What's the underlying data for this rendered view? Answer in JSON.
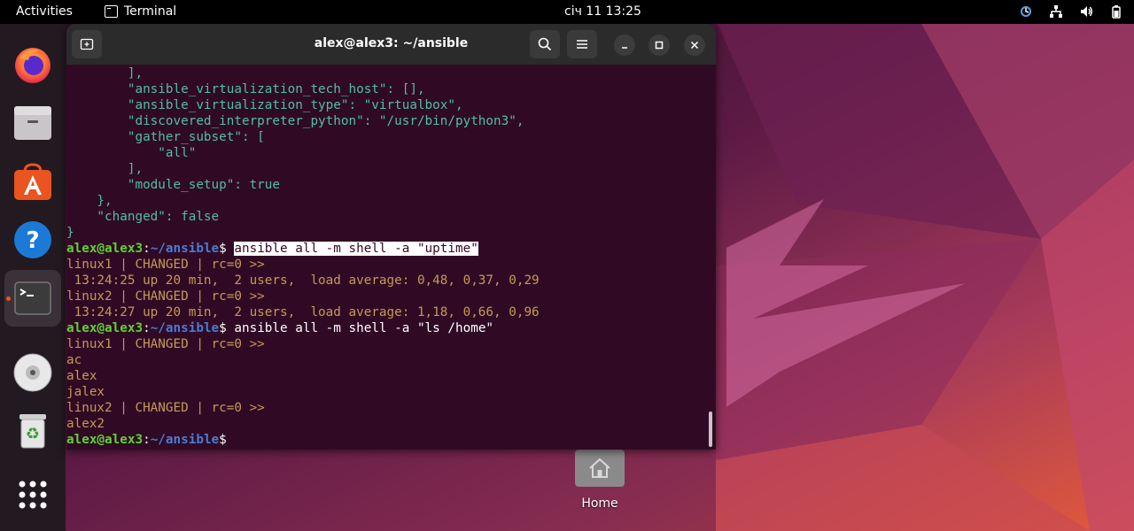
{
  "topbar": {
    "activities": "Activities",
    "app_name": "Terminal",
    "clock": "січ 11  13:25"
  },
  "dock": {
    "items": [
      "Firefox",
      "Files",
      "Ubuntu Software",
      "Help",
      "Terminal",
      "Optical Disc",
      "Trash",
      "Show Applications"
    ],
    "active_item": "Terminal"
  },
  "terminal": {
    "title": "alex@alex3: ~/ansible",
    "prompt_user": "alex@alex3",
    "prompt_sep": ":",
    "prompt_path": "~/ansible",
    "prompt_dollar": "$",
    "lines": [
      "        ],",
      "        \"ansible_virtualization_tech_host\": [],",
      "        \"ansible_virtualization_type\": \"virtualbox\",",
      "        \"discovered_interpreter_python\": \"/usr/bin/python3\",",
      "        \"gather_subset\": [",
      "            \"all\"",
      "        ],",
      "        \"module_setup\": true",
      "    },",
      "    \"changed\": false",
      "}"
    ],
    "cmd1": "ansible all -m shell -a \"uptime\"",
    "out1": [
      "linux1 | CHANGED | rc=0 >>",
      " 13:24:25 up 20 min,  2 users,  load average: 0,48, 0,37, 0,29",
      "linux2 | CHANGED | rc=0 >>",
      " 13:24:27 up 20 min,  2 users,  load average: 1,18, 0,66, 0,96"
    ],
    "cmd2": "ansible all -m shell -a \"ls /home\"",
    "out2": [
      "linux1 | CHANGED | rc=0 >>",
      "ac",
      "alex",
      "jalex",
      "linux2 | CHANGED | rc=0 >>",
      "alex2"
    ]
  },
  "desktop": {
    "home_label": "Home"
  },
  "colors": {
    "accent": "#e95420",
    "terminal_bg": "#300a24",
    "json_text": "#4fbfa4",
    "output_text": "#c59a53",
    "prompt_user": "#5fd130",
    "prompt_path": "#4a7cd4"
  }
}
